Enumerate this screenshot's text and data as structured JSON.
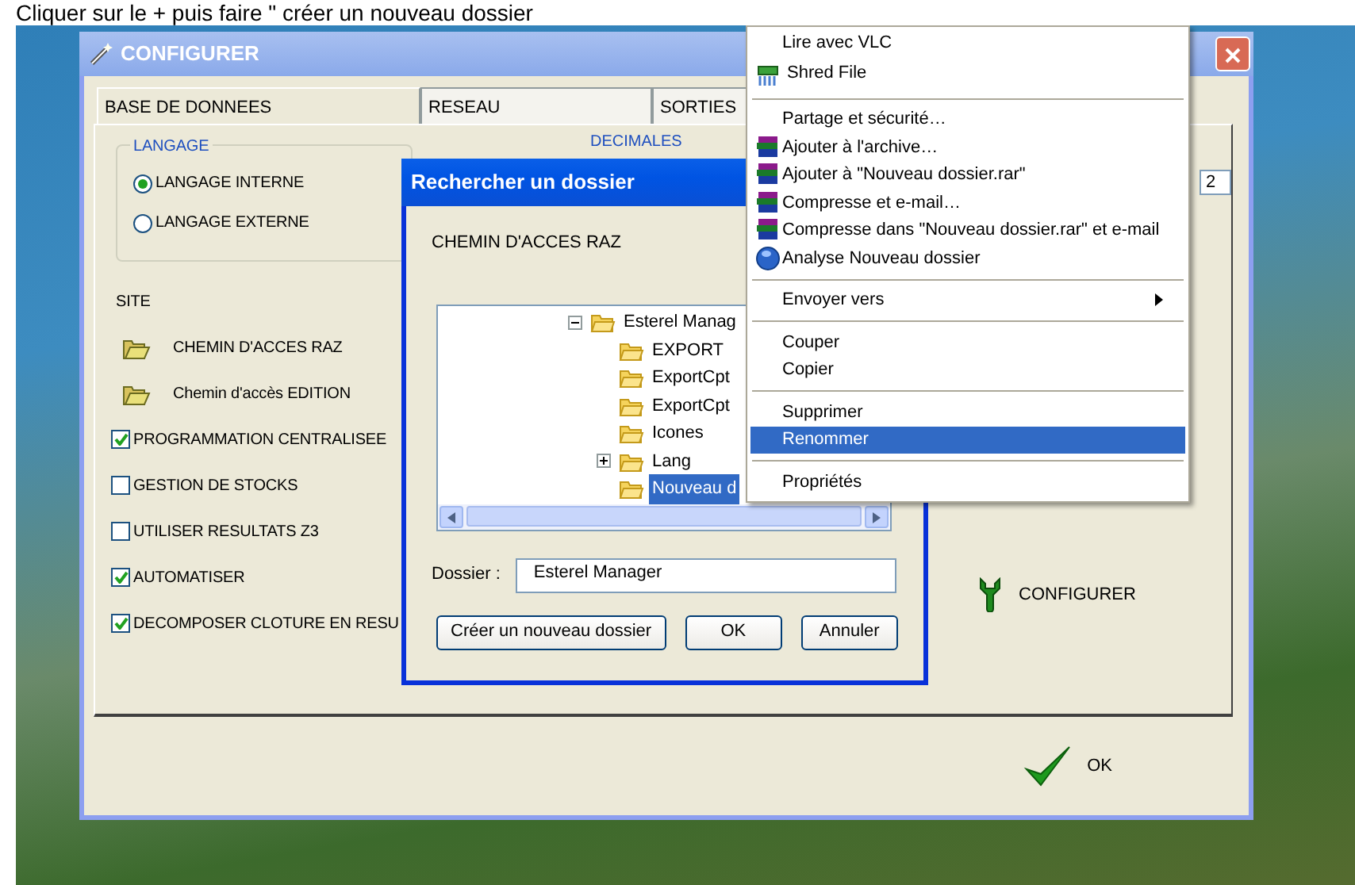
{
  "caption": "Cliquer sur le + puis faire \" créer un nouveau dossier",
  "window": {
    "title": "CONFIGURER"
  },
  "tabs": [
    {
      "label": "BASE DE DONNEES",
      "selected": true
    },
    {
      "label": "RESEAU",
      "selected": false
    },
    {
      "label": "SORTIES",
      "selected": false
    }
  ],
  "language_group": {
    "title": "LANGAGE",
    "options": [
      {
        "label": "LANGAGE INTERNE",
        "selected": true
      },
      {
        "label": "LANGAGE EXTERNE",
        "selected": false
      }
    ]
  },
  "decimals": {
    "label": "DECIMALES",
    "value": "2"
  },
  "site": {
    "title": "SITE",
    "paths": [
      "CHEMIN D'ACCES RAZ",
      "Chemin d'accès EDITION"
    ]
  },
  "options": [
    {
      "label": "PROGRAMMATION CENTRALISEE",
      "checked": true
    },
    {
      "label": "GESTION DE STOCKS",
      "checked": false
    },
    {
      "label": "UTILISER RESULTATS Z3",
      "checked": false
    },
    {
      "label": "AUTOMATISER",
      "checked": true
    },
    {
      "label": "DECOMPOSER CLOTURE EN RESU",
      "checked": true
    }
  ],
  "configure_button": "CONFIGURER",
  "ok_button": "OK",
  "folder_dialog": {
    "title": "Rechercher un dossier",
    "prompt": "CHEMIN D'ACCES RAZ",
    "tree": [
      {
        "label": "Esterel Manag",
        "expanded": true,
        "selected": false,
        "children": [
          {
            "label": "EXPORT",
            "selected": false
          },
          {
            "label": "ExportCpt",
            "selected": false
          },
          {
            "label": "ExportCpt",
            "selected": false
          },
          {
            "label": "Icones",
            "selected": false
          },
          {
            "label": "Lang",
            "expanded": false,
            "selected": false
          },
          {
            "label": "Nouveau d",
            "selected": true
          }
        ]
      }
    ],
    "folder_label": "Dossier :",
    "folder_value": "Esterel Manager",
    "buttons": [
      "Créer un nouveau dossier",
      "OK",
      "Annuler"
    ]
  },
  "context_menu": [
    {
      "kind": "item",
      "label": "Lire avec VLC",
      "selected": false
    },
    {
      "kind": "shredder",
      "label": "Shred File",
      "selected": false
    },
    {
      "kind": "separator"
    },
    {
      "kind": "item",
      "label": "Partage et sécurité…",
      "selected": false
    },
    {
      "kind": "archive",
      "label": "Ajouter à l'archive…",
      "selected": false
    },
    {
      "kind": "archive",
      "label": "Ajouter à \"Nouveau dossier.rar\"",
      "selected": false
    },
    {
      "kind": "archive",
      "label": "Compresse et e-mail…",
      "selected": false
    },
    {
      "kind": "archive",
      "label": "Compresse dans \"Nouveau dossier.rar\" et e-mail",
      "selected": false
    },
    {
      "kind": "scan",
      "label": "Analyse Nouveau dossier",
      "selected": false
    },
    {
      "kind": "separator"
    },
    {
      "kind": "submenu",
      "label": "Envoyer vers",
      "selected": false
    },
    {
      "kind": "separator"
    },
    {
      "kind": "item",
      "label": "Couper",
      "selected": false
    },
    {
      "kind": "item",
      "label": "Copier",
      "selected": false
    },
    {
      "kind": "separator"
    },
    {
      "kind": "item",
      "label": "Supprimer",
      "selected": false
    },
    {
      "kind": "item",
      "label": "Renommer",
      "selected": true
    },
    {
      "kind": "separator"
    },
    {
      "kind": "item",
      "label": "Propriétés",
      "selected": false
    }
  ]
}
